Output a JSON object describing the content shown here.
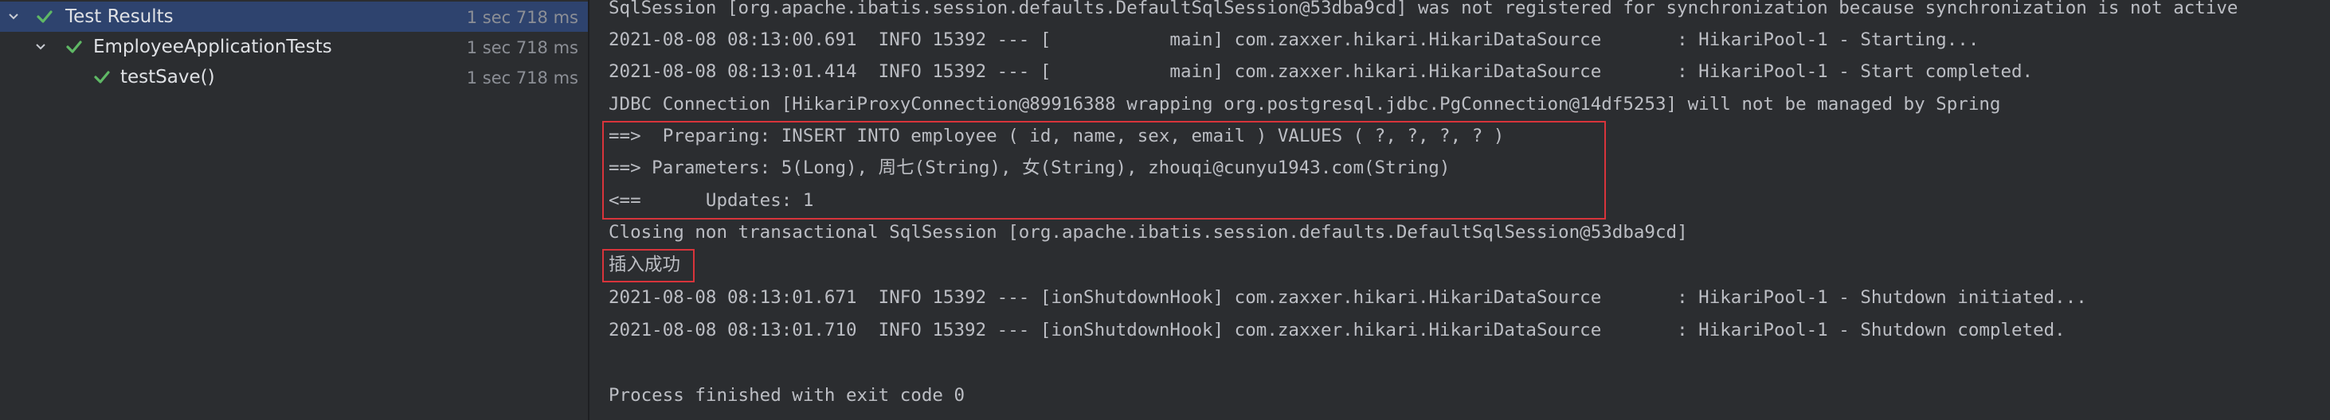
{
  "test_tree": {
    "root": {
      "label": "Test Results",
      "time": "1 sec 718 ms"
    },
    "class": {
      "label": "EmployeeApplicationTests",
      "time": "1 sec 718 ms"
    },
    "method": {
      "label": "testSave()",
      "time": "1 sec 718 ms"
    }
  },
  "console": {
    "lines": [
      "SqlSession [org.apache.ibatis.session.defaults.DefaultSqlSession@53dba9cd] was not registered for synchronization because synchronization is not active",
      "2021-08-08 08:13:00.691  INFO 15392 --- [           main] com.zaxxer.hikari.HikariDataSource       : HikariPool-1 - Starting...",
      "2021-08-08 08:13:01.414  INFO 15392 --- [           main] com.zaxxer.hikari.HikariDataSource       : HikariPool-1 - Start completed.",
      "JDBC Connection [HikariProxyConnection@89916388 wrapping org.postgresql.jdbc.PgConnection@14df5253] will not be managed by Spring",
      "==>  Preparing: INSERT INTO employee ( id, name, sex, email ) VALUES ( ?, ?, ?, ? )",
      "==> Parameters: 5(Long), 周七(String), 女(String), zhouqi@cunyu1943.com(String)",
      "<==      Updates: 1",
      "Closing non transactional SqlSession [org.apache.ibatis.session.defaults.DefaultSqlSession@53dba9cd]",
      "插入成功",
      "2021-08-08 08:13:01.671  INFO 15392 --- [ionShutdownHook] com.zaxxer.hikari.HikariDataSource       : HikariPool-1 - Shutdown initiated...",
      "2021-08-08 08:13:01.710  INFO 15392 --- [ionShutdownHook] com.zaxxer.hikari.HikariDataSource       : HikariPool-1 - Shutdown completed.",
      "",
      "Process finished with exit code 0"
    ]
  },
  "colors": {
    "background": "#2b2d30",
    "selection": "#2e436e",
    "pass_check": "#5fb865",
    "text": "#bcbec4",
    "highlight_box": "#d8343b"
  }
}
